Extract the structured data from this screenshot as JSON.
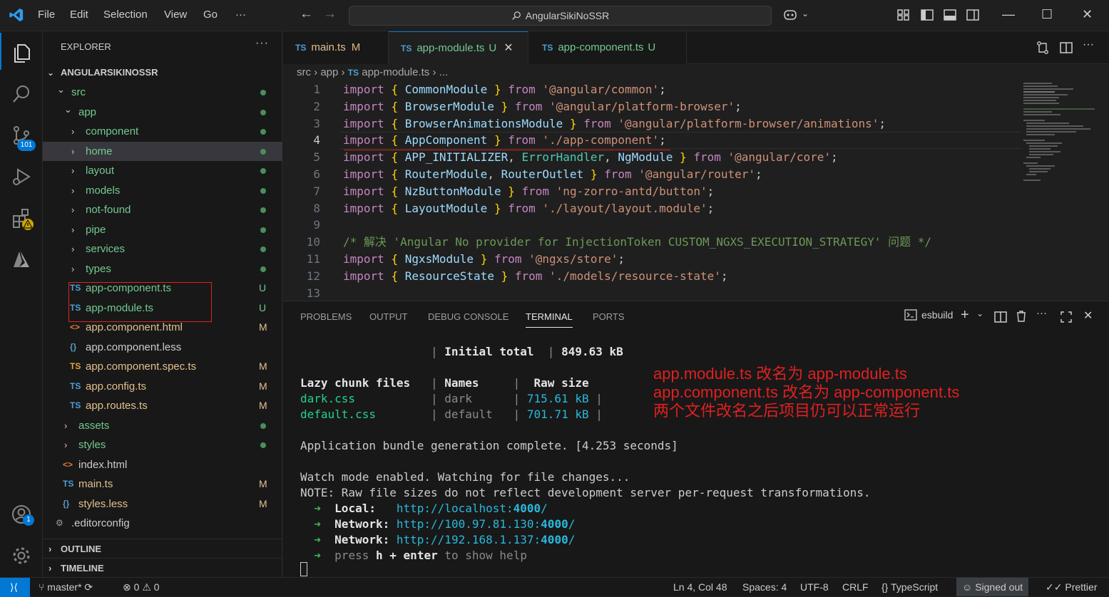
{
  "titlebar": {
    "menus": [
      "File",
      "Edit",
      "Selection",
      "View",
      "Go",
      "···"
    ],
    "search_text": "AngularSikiNoSSR"
  },
  "activity_bar": {
    "scm_badge": "101",
    "accounts_badge": "1"
  },
  "explorer": {
    "header": "EXPLORER",
    "more": "···",
    "root": "ANGULARSIKINOSSR",
    "rows": [
      {
        "label": "src",
        "type": "folder",
        "open": true,
        "indent": 1,
        "status": "dot"
      },
      {
        "label": "app",
        "type": "folder",
        "open": true,
        "indent": 2,
        "status": "dot"
      },
      {
        "label": "component",
        "type": "folder",
        "open": false,
        "indent": 3,
        "status": "dot"
      },
      {
        "label": "home",
        "type": "folder",
        "open": false,
        "indent": 3,
        "status": "dot",
        "selected": true
      },
      {
        "label": "layout",
        "type": "folder",
        "open": false,
        "indent": 3,
        "status": "dot"
      },
      {
        "label": "models",
        "type": "folder",
        "open": false,
        "indent": 3,
        "status": "dot"
      },
      {
        "label": "not-found",
        "type": "folder",
        "open": false,
        "indent": 3,
        "status": "dot"
      },
      {
        "label": "pipe",
        "type": "folder",
        "open": false,
        "indent": 3,
        "status": "dot"
      },
      {
        "label": "services",
        "type": "folder",
        "open": false,
        "indent": 3,
        "status": "dot"
      },
      {
        "label": "types",
        "type": "folder",
        "open": false,
        "indent": 3,
        "status": "dot"
      },
      {
        "label": "app-component.ts",
        "type": "ts",
        "indent": 3,
        "status": "U",
        "color": "#73c991"
      },
      {
        "label": "app-module.ts",
        "type": "ts",
        "indent": 3,
        "status": "U",
        "color": "#73c991"
      },
      {
        "label": "app.component.html",
        "type": "html",
        "indent": 3,
        "status": "M",
        "color": "#e2c08d"
      },
      {
        "label": "app.component.less",
        "type": "less",
        "indent": 3,
        "status": "",
        "color": "#cccccc"
      },
      {
        "label": "app.component.spec.ts",
        "type": "spec",
        "indent": 3,
        "status": "M",
        "color": "#e2c08d"
      },
      {
        "label": "app.config.ts",
        "type": "ts",
        "indent": 3,
        "status": "M",
        "color": "#e2c08d"
      },
      {
        "label": "app.routes.ts",
        "type": "ts",
        "indent": 3,
        "status": "M",
        "color": "#e2c08d"
      },
      {
        "label": "assets",
        "type": "folder",
        "open": false,
        "indent": 2,
        "status": "dot"
      },
      {
        "label": "styles",
        "type": "folder",
        "open": false,
        "indent": 2,
        "status": "dot"
      },
      {
        "label": "index.html",
        "type": "html",
        "indent": 2,
        "status": "",
        "color": "#cccccc"
      },
      {
        "label": "main.ts",
        "type": "ts",
        "indent": 2,
        "status": "M",
        "color": "#e2c08d"
      },
      {
        "label": "styles.less",
        "type": "less",
        "indent": 2,
        "status": "M",
        "color": "#e2c08d"
      },
      {
        "label": ".editorconfig",
        "type": "gear",
        "indent": 1,
        "status": "",
        "color": "#cccccc"
      }
    ],
    "outline": "OUTLINE",
    "timeline": "TIMELINE"
  },
  "tabs": [
    {
      "label": "main.ts",
      "status": "M",
      "active": false
    },
    {
      "label": "app-module.ts",
      "status": "U",
      "active": true
    },
    {
      "label": "app-component.ts",
      "status": "U",
      "active": false
    }
  ],
  "breadcrumb": {
    "p1": "src",
    "p2": "app",
    "file": "app-module.ts",
    "tail": "..."
  },
  "code": {
    "cursor_line": 4,
    "lines": [
      [
        [
          "kw",
          "import"
        ],
        [
          "pl",
          " "
        ],
        [
          "br",
          "{"
        ],
        [
          "pl",
          " "
        ],
        [
          "id",
          "CommonModule"
        ],
        [
          "pl",
          " "
        ],
        [
          "br",
          "}"
        ],
        [
          "pl",
          " "
        ],
        [
          "kw",
          "from"
        ],
        [
          "pl",
          " "
        ],
        [
          "str",
          "'@angular/common'"
        ],
        [
          "pl",
          ";"
        ]
      ],
      [
        [
          "kw",
          "import"
        ],
        [
          "pl",
          " "
        ],
        [
          "br",
          "{"
        ],
        [
          "pl",
          " "
        ],
        [
          "id",
          "BrowserModule"
        ],
        [
          "pl",
          " "
        ],
        [
          "br",
          "}"
        ],
        [
          "pl",
          " "
        ],
        [
          "kw",
          "from"
        ],
        [
          "pl",
          " "
        ],
        [
          "str",
          "'@angular/platform-browser'"
        ],
        [
          "pl",
          ";"
        ]
      ],
      [
        [
          "kw",
          "import"
        ],
        [
          "pl",
          " "
        ],
        [
          "br",
          "{"
        ],
        [
          "pl",
          " "
        ],
        [
          "id",
          "BrowserAnimationsModule"
        ],
        [
          "pl",
          " "
        ],
        [
          "br",
          "}"
        ],
        [
          "pl",
          " "
        ],
        [
          "kw",
          "from"
        ],
        [
          "pl",
          " "
        ],
        [
          "str",
          "'@angular/platform-browser/animations'"
        ],
        [
          "pl",
          ";"
        ]
      ],
      [
        [
          "kw",
          "import"
        ],
        [
          "pl",
          " "
        ],
        [
          "br",
          "{"
        ],
        [
          "pl",
          " "
        ],
        [
          "id",
          "AppComponent"
        ],
        [
          "pl",
          " "
        ],
        [
          "br",
          "}"
        ],
        [
          "pl",
          " "
        ],
        [
          "kw",
          "from"
        ],
        [
          "pl",
          " "
        ],
        [
          "str",
          "'./app-component'"
        ],
        [
          "pl",
          ";"
        ]
      ],
      [
        [
          "kw",
          "import"
        ],
        [
          "pl",
          " "
        ],
        [
          "br",
          "{"
        ],
        [
          "pl",
          " "
        ],
        [
          "id",
          "APP_INITIALIZER"
        ],
        [
          "pl",
          ", "
        ],
        [
          "ty",
          "ErrorHandler"
        ],
        [
          "pl",
          ", "
        ],
        [
          "id",
          "NgModule"
        ],
        [
          "pl",
          " "
        ],
        [
          "br",
          "}"
        ],
        [
          "pl",
          " "
        ],
        [
          "kw",
          "from"
        ],
        [
          "pl",
          " "
        ],
        [
          "str",
          "'@angular/core'"
        ],
        [
          "pl",
          ";"
        ]
      ],
      [
        [
          "kw",
          "import"
        ],
        [
          "pl",
          " "
        ],
        [
          "br",
          "{"
        ],
        [
          "pl",
          " "
        ],
        [
          "id",
          "RouterModule"
        ],
        [
          "pl",
          ", "
        ],
        [
          "id",
          "RouterOutlet"
        ],
        [
          "pl",
          " "
        ],
        [
          "br",
          "}"
        ],
        [
          "pl",
          " "
        ],
        [
          "kw",
          "from"
        ],
        [
          "pl",
          " "
        ],
        [
          "str",
          "'@angular/router'"
        ],
        [
          "pl",
          ";"
        ]
      ],
      [
        [
          "kw",
          "import"
        ],
        [
          "pl",
          " "
        ],
        [
          "br",
          "{"
        ],
        [
          "pl",
          " "
        ],
        [
          "id",
          "NzButtonModule"
        ],
        [
          "pl",
          " "
        ],
        [
          "br",
          "}"
        ],
        [
          "pl",
          " "
        ],
        [
          "kw",
          "from"
        ],
        [
          "pl",
          " "
        ],
        [
          "str",
          "'ng-zorro-antd/button'"
        ],
        [
          "pl",
          ";"
        ]
      ],
      [
        [
          "kw",
          "import"
        ],
        [
          "pl",
          " "
        ],
        [
          "br",
          "{"
        ],
        [
          "pl",
          " "
        ],
        [
          "id",
          "LayoutModule"
        ],
        [
          "pl",
          " "
        ],
        [
          "br",
          "}"
        ],
        [
          "pl",
          " "
        ],
        [
          "kw",
          "from"
        ],
        [
          "pl",
          " "
        ],
        [
          "str",
          "'./layout/layout.module'"
        ],
        [
          "pl",
          ";"
        ]
      ],
      [],
      [
        [
          "cm",
          "/* 解决 'Angular No provider for InjectionToken CUSTOM_NGXS_EXECUTION_STRATEGY' 问题 */"
        ]
      ],
      [
        [
          "kw",
          "import"
        ],
        [
          "pl",
          " "
        ],
        [
          "br",
          "{"
        ],
        [
          "pl",
          " "
        ],
        [
          "id",
          "NgxsModule"
        ],
        [
          "pl",
          " "
        ],
        [
          "br",
          "}"
        ],
        [
          "pl",
          " "
        ],
        [
          "kw",
          "from"
        ],
        [
          "pl",
          " "
        ],
        [
          "str",
          "'@ngxs/store'"
        ],
        [
          "pl",
          ";"
        ]
      ],
      [
        [
          "kw",
          "import"
        ],
        [
          "pl",
          " "
        ],
        [
          "br",
          "{"
        ],
        [
          "pl",
          " "
        ],
        [
          "id",
          "ResourceState"
        ],
        [
          "pl",
          " "
        ],
        [
          "br",
          "}"
        ],
        [
          "pl",
          " "
        ],
        [
          "kw",
          "from"
        ],
        [
          "pl",
          " "
        ],
        [
          "str",
          "'./models/resource-state'"
        ],
        [
          "pl",
          ";"
        ]
      ],
      []
    ]
  },
  "panel": {
    "tabs": [
      "PROBLEMS",
      "OUTPUT",
      "DEBUG CONSOLE",
      "TERMINAL",
      "PORTS"
    ],
    "active_tab": "TERMINAL",
    "terminal_name": "esbuild"
  },
  "terminal": {
    "initial_total_label": "Initial total",
    "initial_total_size": "849.63 kB",
    "lazy_header": "Lazy chunk files",
    "names_header": "Names",
    "raw_size_header": "Raw size",
    "chunks": [
      {
        "file": "dark.css",
        "name": "dark",
        "size": "715.61 kB"
      },
      {
        "file": "default.css",
        "name": "default",
        "size": "701.71 kB"
      }
    ],
    "bundle_line": "Application bundle generation complete. [4.253 seconds]",
    "watch_line": "Watch mode enabled. Watching for file changes...",
    "note_line": "NOTE: Raw file sizes do not reflect development server per-request transformations.",
    "local_label": "Local:",
    "local_url_prefix": "http://localhost:",
    "local_port": "4000",
    "network_label": "Network:",
    "network1_prefix": "http://100.97.81.130:",
    "network2_prefix": "http://192.168.1.137:",
    "port": "4000",
    "slash": "/",
    "press": "press",
    "h": "h",
    "plus": "+",
    "enter": "enter",
    "show_help": "to show help"
  },
  "annotation": {
    "line1": "app.module.ts 改名为 app-module.ts",
    "line2": "app.component.ts 改名为 app-component.ts",
    "line3": "两个文件改名之后项目仍可以正常运行"
  },
  "statusbar": {
    "branch": "master*",
    "errors": "0",
    "warnings": "0",
    "position": "Ln 4, Col 48",
    "spaces": "Spaces: 4",
    "encoding": "UTF-8",
    "eol": "CRLF",
    "language": "TypeScript",
    "signed": "Signed out",
    "prettier": "Prettier"
  }
}
